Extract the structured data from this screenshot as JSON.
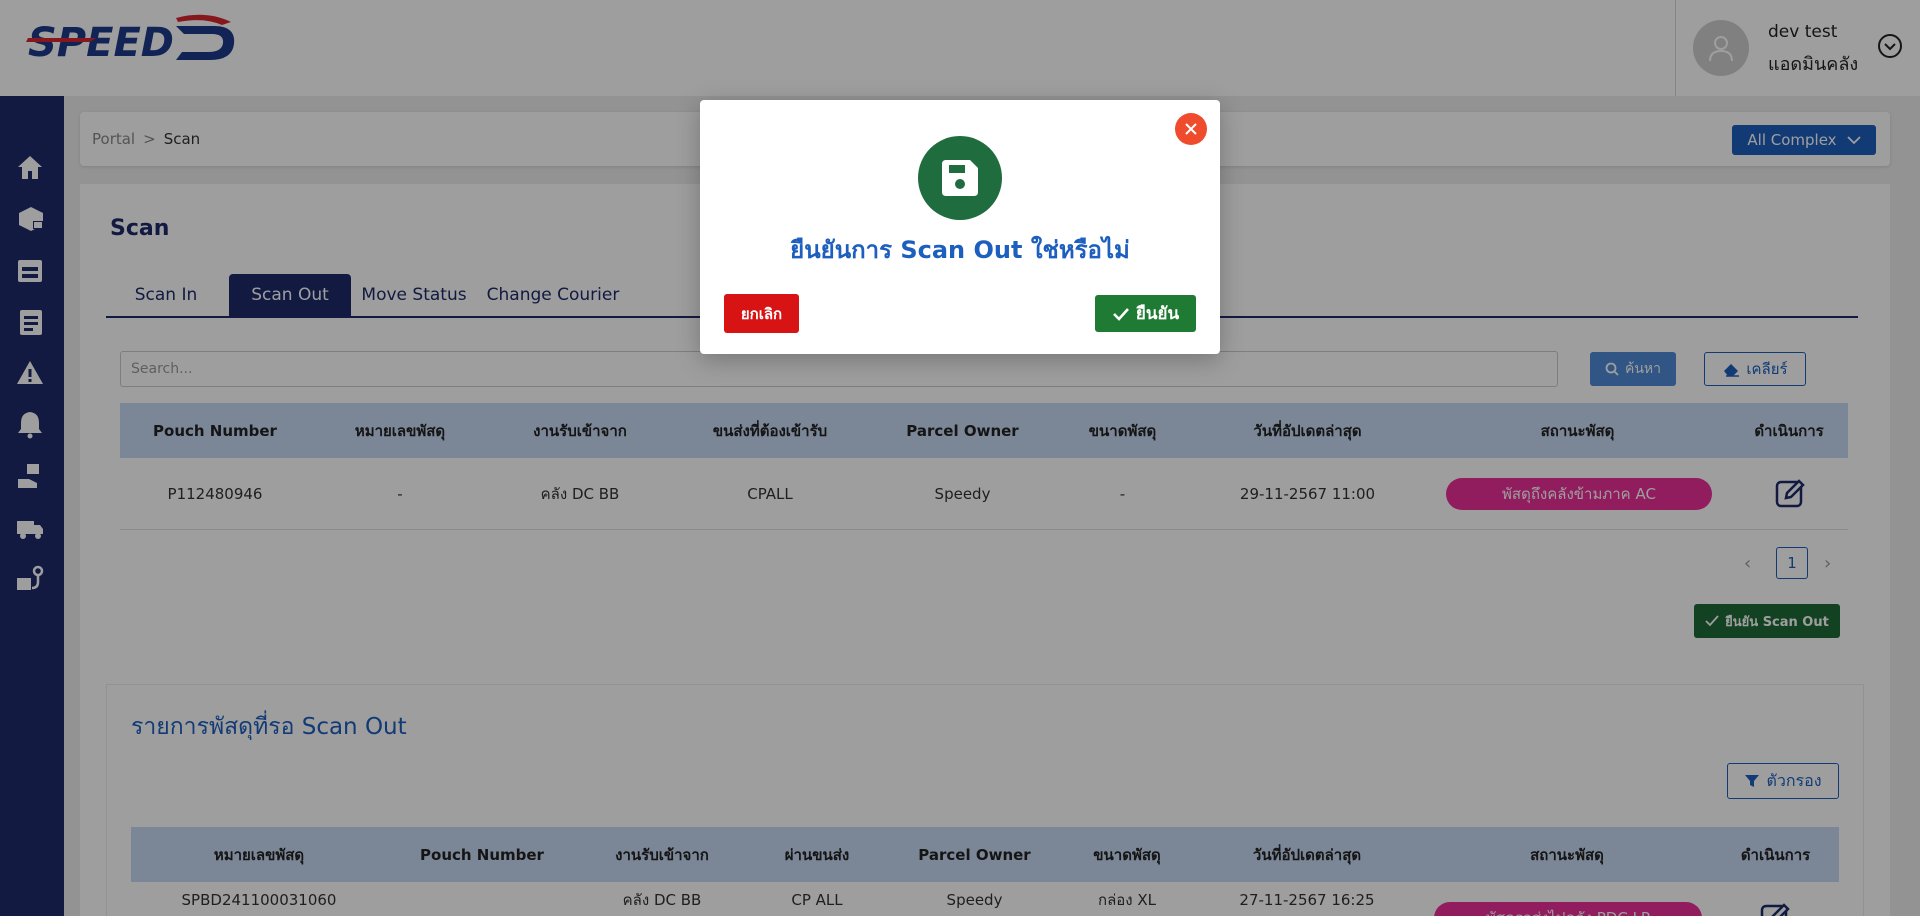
{
  "header": {
    "logo_text": "SPEED-D",
    "user_name": "dev test",
    "user_role": "แอดมินคลัง"
  },
  "sidebar": {
    "items": [
      {
        "icon": "home-icon"
      },
      {
        "icon": "parcel-inbound-icon"
      },
      {
        "icon": "warehouse-icon"
      },
      {
        "icon": "report-icon"
      },
      {
        "icon": "warning-icon"
      },
      {
        "icon": "notification-bell-icon"
      },
      {
        "icon": "parcel-handling-icon"
      },
      {
        "icon": "truck-icon"
      },
      {
        "icon": "route-icon"
      }
    ]
  },
  "breadcrumb": {
    "root": "Portal",
    "separator": ">",
    "current": "Scan"
  },
  "complex_select": {
    "value": "All Complex"
  },
  "page": {
    "title": "Scan"
  },
  "tabs": [
    {
      "label": "Scan In"
    },
    {
      "label": "Scan Out"
    },
    {
      "label": "Move Status"
    },
    {
      "label": "Change Courier"
    }
  ],
  "search": {
    "placeholder": "Search...",
    "search_label": "ค้นหา",
    "clear_label": "เคลียร์"
  },
  "table1": {
    "headers": [
      "Pouch Number",
      "หมายเลขพัสดุ",
      "งานรับเข้าจาก",
      "ขนส่งที่ต้องเข้ารับ",
      "Parcel Owner",
      "ขนาดพัสดุ",
      "วันที่อัปเดตล่าสุด",
      "สถานะพัสดุ",
      "ดำเนินการ"
    ],
    "rows": [
      {
        "pouch_number": "P112480946",
        "parcel_number": "-",
        "received_from": "คลัง DC BB",
        "courier": "CPALL",
        "parcel_owner": "Speedy",
        "size": "-",
        "updated": "29-11-2567 11:00",
        "status": "พัสดุถึงคลังข้ามภาค AC"
      }
    ]
  },
  "pagination": {
    "current_page": "1",
    "prev": "‹",
    "next": "›"
  },
  "confirm_scan_out_label": "ยืนยัน Scan Out",
  "pending": {
    "title": "รายการพัสดุที่รอ Scan Out",
    "filter_label": "ตัวกรอง",
    "headers": [
      "หมายเลขพัสดุ",
      "Pouch Number",
      "งานรับเข้าจาก",
      "ผ่านขนส่ง",
      "Parcel Owner",
      "ขนาดพัสดุ",
      "วันที่อัปเดตล่าสุด",
      "สถานะพัสดุ",
      "ดำเนินการ"
    ],
    "rows": [
      {
        "parcel_number": "SPBD241100031060",
        "pouch_number": "",
        "received_from": "คลัง DC BB",
        "courier": "CP ALL",
        "parcel_owner": "Speedy",
        "size": "กล่อง XL",
        "updated": "27-11-2567 16:25",
        "status": "พัสดุรอส่งไปคลัง PDC LP"
      }
    ]
  },
  "modal": {
    "message": "ยืนยันการ Scan Out ใช่หรือไม่",
    "cancel_label": "ยกเลิก",
    "confirm_label": "ยืนยัน"
  },
  "colors": {
    "navy": "#1d2b6b",
    "primary_blue": "#1d5fbe",
    "status_pink": "#ea2f9a",
    "confirm_green": "#1f7a33",
    "cancel_red": "#d81313",
    "close_orange": "#ef4c2e"
  }
}
